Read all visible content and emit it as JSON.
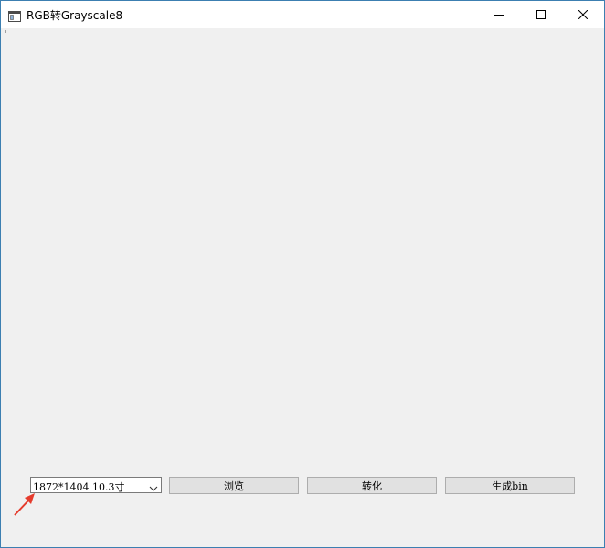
{
  "window": {
    "title": "RGB转Grayscale8"
  },
  "controls": {
    "resolution_select": {
      "selected": "1872*1404 10.3寸"
    },
    "browse_label": "浏览",
    "convert_label": "转化",
    "generate_bin_label": "生成bin"
  },
  "colors": {
    "window_background": "#f0f0f0",
    "window_border": "#3c7fb1",
    "button_face": "#e1e1e1",
    "button_border": "#adadad",
    "annotation_arrow": "#e53b2c"
  },
  "icons": {
    "app": "app-window-icon",
    "minimize": "minimize-icon",
    "maximize": "maximize-icon",
    "close": "close-icon",
    "dropdown": "chevron-down-icon",
    "annotation": "red-arrow-annotation"
  }
}
